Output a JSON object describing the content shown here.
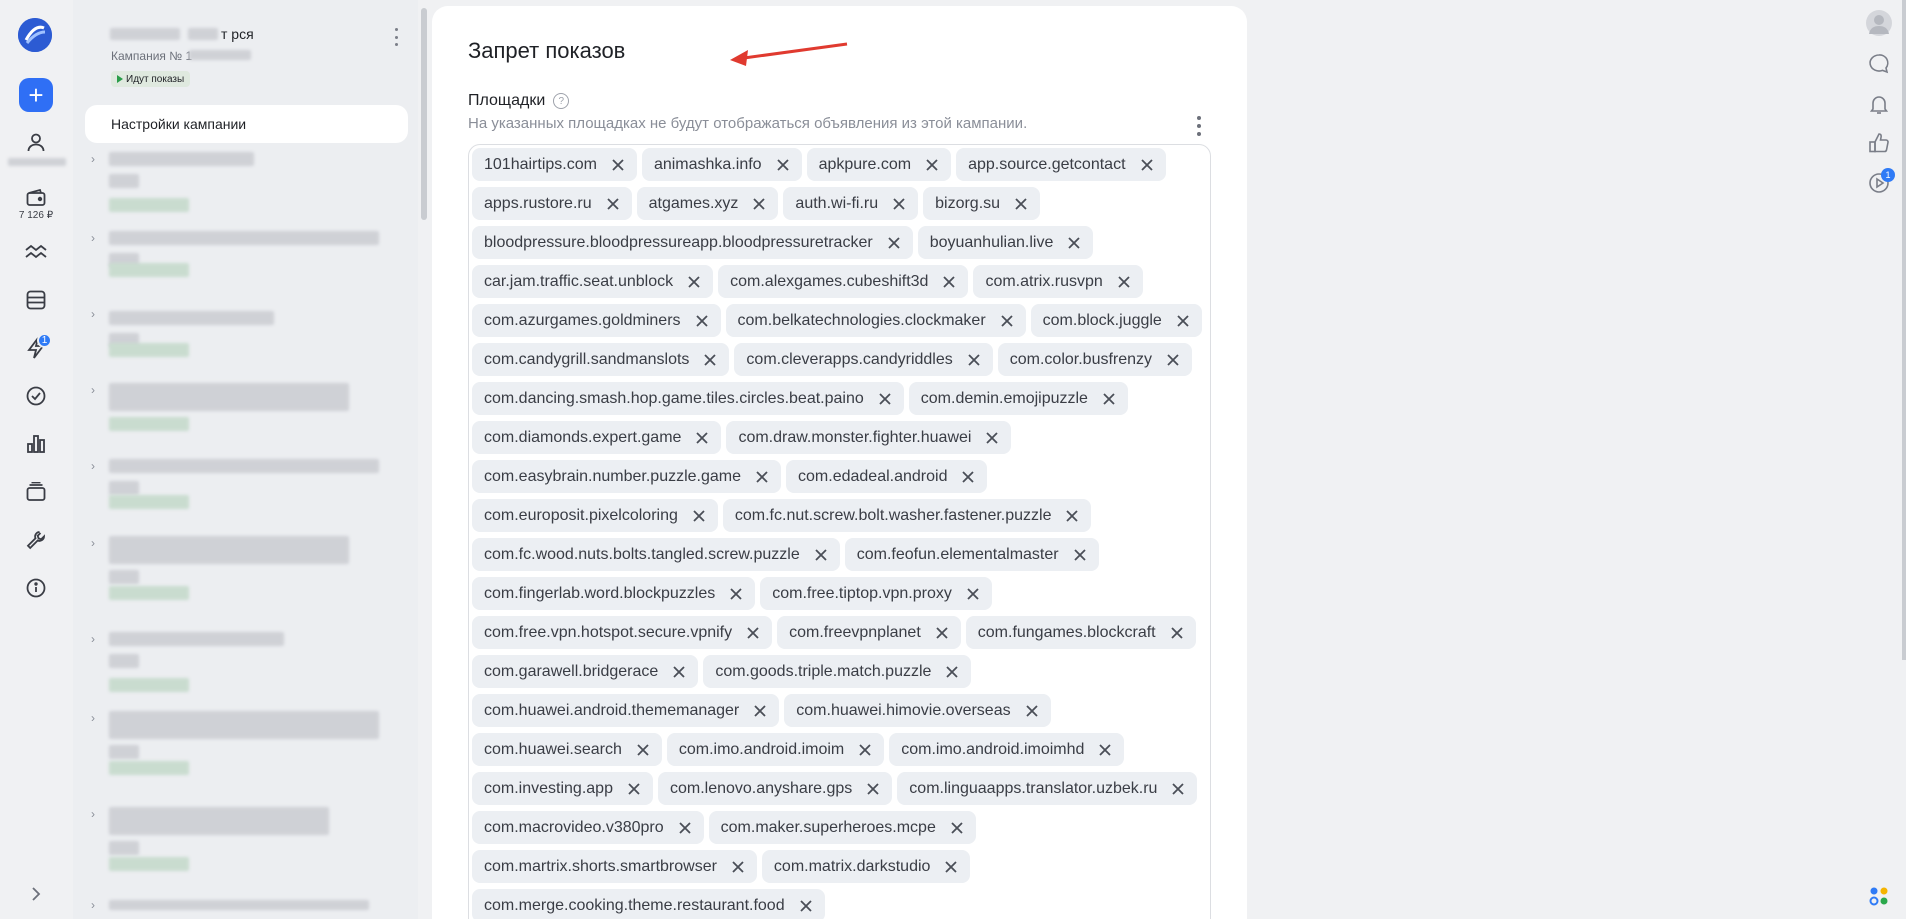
{
  "rail": {
    "balance": "7 126 ₽",
    "notifications_badge": "1",
    "icons": [
      "logo-icon",
      "plus-icon",
      "user-icon",
      "wallet-icon",
      "waves-icon",
      "table-icon",
      "lightning-icon",
      "check-circle-icon",
      "bar-chart-icon",
      "layers-icon",
      "wrench-icon",
      "info-icon",
      "expand-chevron-icon"
    ]
  },
  "campaign": {
    "name": "т рся",
    "number": "Кампания № 1",
    "status": "Идут показы",
    "settings_label": "Настройки кампании"
  },
  "main": {
    "title": "Запрет показов",
    "field_label": "Площадки",
    "field_hint": "На указанных площадках не будут отображаться объявления из этой кампании.",
    "tags": [
      "101hairtips.com",
      "animashka.info",
      "apkpure.com",
      "app.source.getcontact",
      "apps.rustore.ru",
      "atgames.xyz",
      "auth.wi-fi.ru",
      "bizorg.su",
      "bloodpressure.bloodpressureapp.bloodpressuretracker",
      "boyuanhulian.live",
      "car.jam.traffic.seat.unblock",
      "com.alexgames.cubeshift3d",
      "com.atrix.rusvpn",
      "com.azurgames.goldminers",
      "com.belkatechnologies.clockmaker",
      "com.block.juggle",
      "com.candygrill.sandmanslots",
      "com.cleverapps.candyriddles",
      "com.color.busfrenzy",
      "com.dancing.smash.hop.game.tiles.circles.beat.paino",
      "com.demin.emojipuzzle",
      "com.diamonds.expert.game",
      "com.draw.monster.fighter.huawei",
      "com.easybrain.number.puzzle.game",
      "com.edadeal.android",
      "com.europosit.pixelcoloring",
      "com.fc.nut.screw.bolt.washer.fastener.puzzle",
      "com.fc.wood.nuts.bolts.tangled.screw.puzzle",
      "com.feofun.elementalmaster",
      "com.fingerlab.word.blockpuzzles",
      "com.free.tiptop.vpn.proxy",
      "com.free.vpn.hotspot.secure.vpnify",
      "com.freevpnplanet",
      "com.fungames.blockcraft",
      "com.garawell.bridgerace",
      "com.goods.triple.match.puzzle",
      "com.huawei.android.thememanager",
      "com.huawei.himovie.overseas",
      "com.huawei.search",
      "com.imo.android.imoim",
      "com.imo.android.imoimhd",
      "com.investing.app",
      "com.lenovo.anyshare.gps",
      "com.linguaapps.translator.uzbek.ru",
      "com.macrovideo.v380pro",
      "com.maker.superheroes.mcpe",
      "com.martrix.shorts.smartbrowser",
      "com.matrix.darkstudio",
      "com.merge.cooking.theme.restaurant.food"
    ]
  },
  "right_rail": {
    "badge": "1",
    "icons": [
      "avatar",
      "chat-icon",
      "bell-icon",
      "thumbs-up-icon",
      "play-circle-icon",
      "apps-grid-icon"
    ]
  }
}
